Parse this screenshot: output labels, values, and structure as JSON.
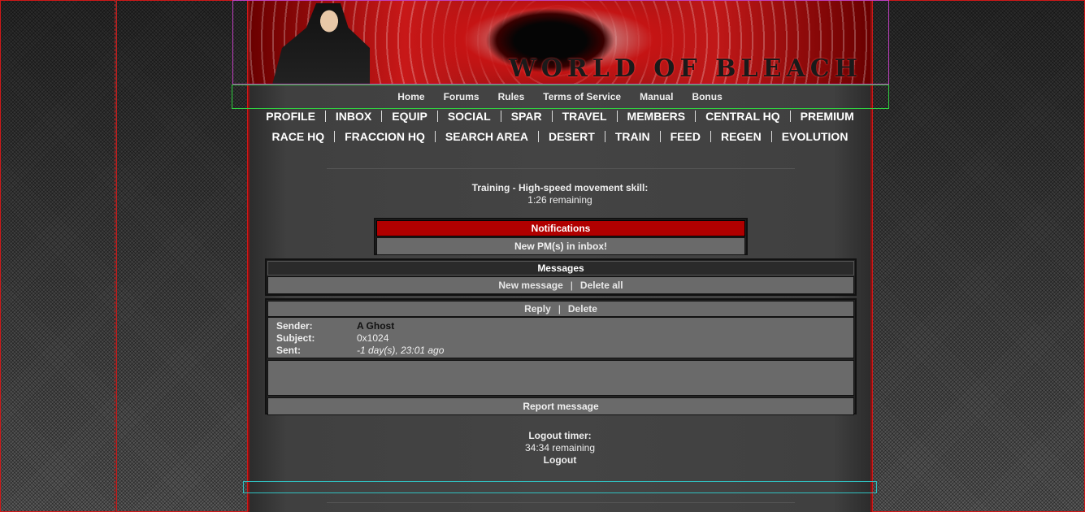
{
  "banner": {
    "logo_text": "WORLD OF BLEACH"
  },
  "topnav": [
    "Home",
    "Forums",
    "Rules",
    "Terms of Service",
    "Manual",
    "Bonus"
  ],
  "gamenav": {
    "row1": [
      "PROFILE",
      "INBOX",
      "EQUIP",
      "SOCIAL",
      "SPAR",
      "TRAVEL",
      "MEMBERS",
      "CENTRAL HQ",
      "PREMIUM"
    ],
    "row2": [
      "RACE HQ",
      "FRACCION HQ",
      "SEARCH AREA",
      "DESERT",
      "TRAIN",
      "FEED",
      "REGEN",
      "EVOLUTION"
    ]
  },
  "training": {
    "label": "Training - High-speed movement skill:",
    "remaining": "1:26 remaining"
  },
  "notifications": {
    "title": "Notifications",
    "message": "New PM(s) in inbox!"
  },
  "messages": {
    "title": "Messages",
    "new_message": "New message",
    "delete_all": "Delete all",
    "separator": "|"
  },
  "message": {
    "reply": "Reply",
    "delete": "Delete",
    "sender_label": "Sender:",
    "sender": "A Ghost",
    "subject_label": "Subject:",
    "subject": "0x1024",
    "sent_label": "Sent:",
    "sent": "-1 day(s), 23:01 ago",
    "body": "",
    "report": "Report message"
  },
  "logout": {
    "label": "Logout timer:",
    "remaining": "34:34 remaining",
    "link": "Logout"
  },
  "colors": {
    "accent_red": "#b00000",
    "page_bg": "#444444",
    "cell_bg": "#6a6a6a"
  }
}
